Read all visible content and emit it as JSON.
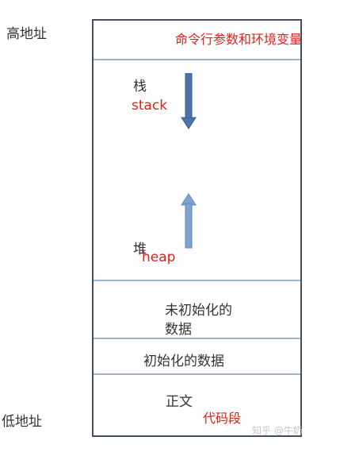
{
  "labels": {
    "high_address": "高地址",
    "low_address": "低地址"
  },
  "segments": {
    "args_env": "命令行参数和环境变量",
    "stack_cn": "栈",
    "stack_en": "stack",
    "heap_cn": "堆",
    "heap_en": "heap",
    "bss_line1": "未初始化的",
    "bss_line2": "数据",
    "data": "初始化的数据",
    "text_cn": "正文",
    "text_red": "代码段"
  },
  "watermark": "知乎 @牛奶",
  "colors": {
    "red": "#e0201c",
    "arrow_blue": "#4a73a8",
    "arrow_light": "#7fa3d1",
    "border": "#444e5c",
    "divider": "#9fb3c8"
  },
  "icons": {
    "stack_arrow": "arrow-down",
    "heap_arrow": "arrow-up"
  }
}
